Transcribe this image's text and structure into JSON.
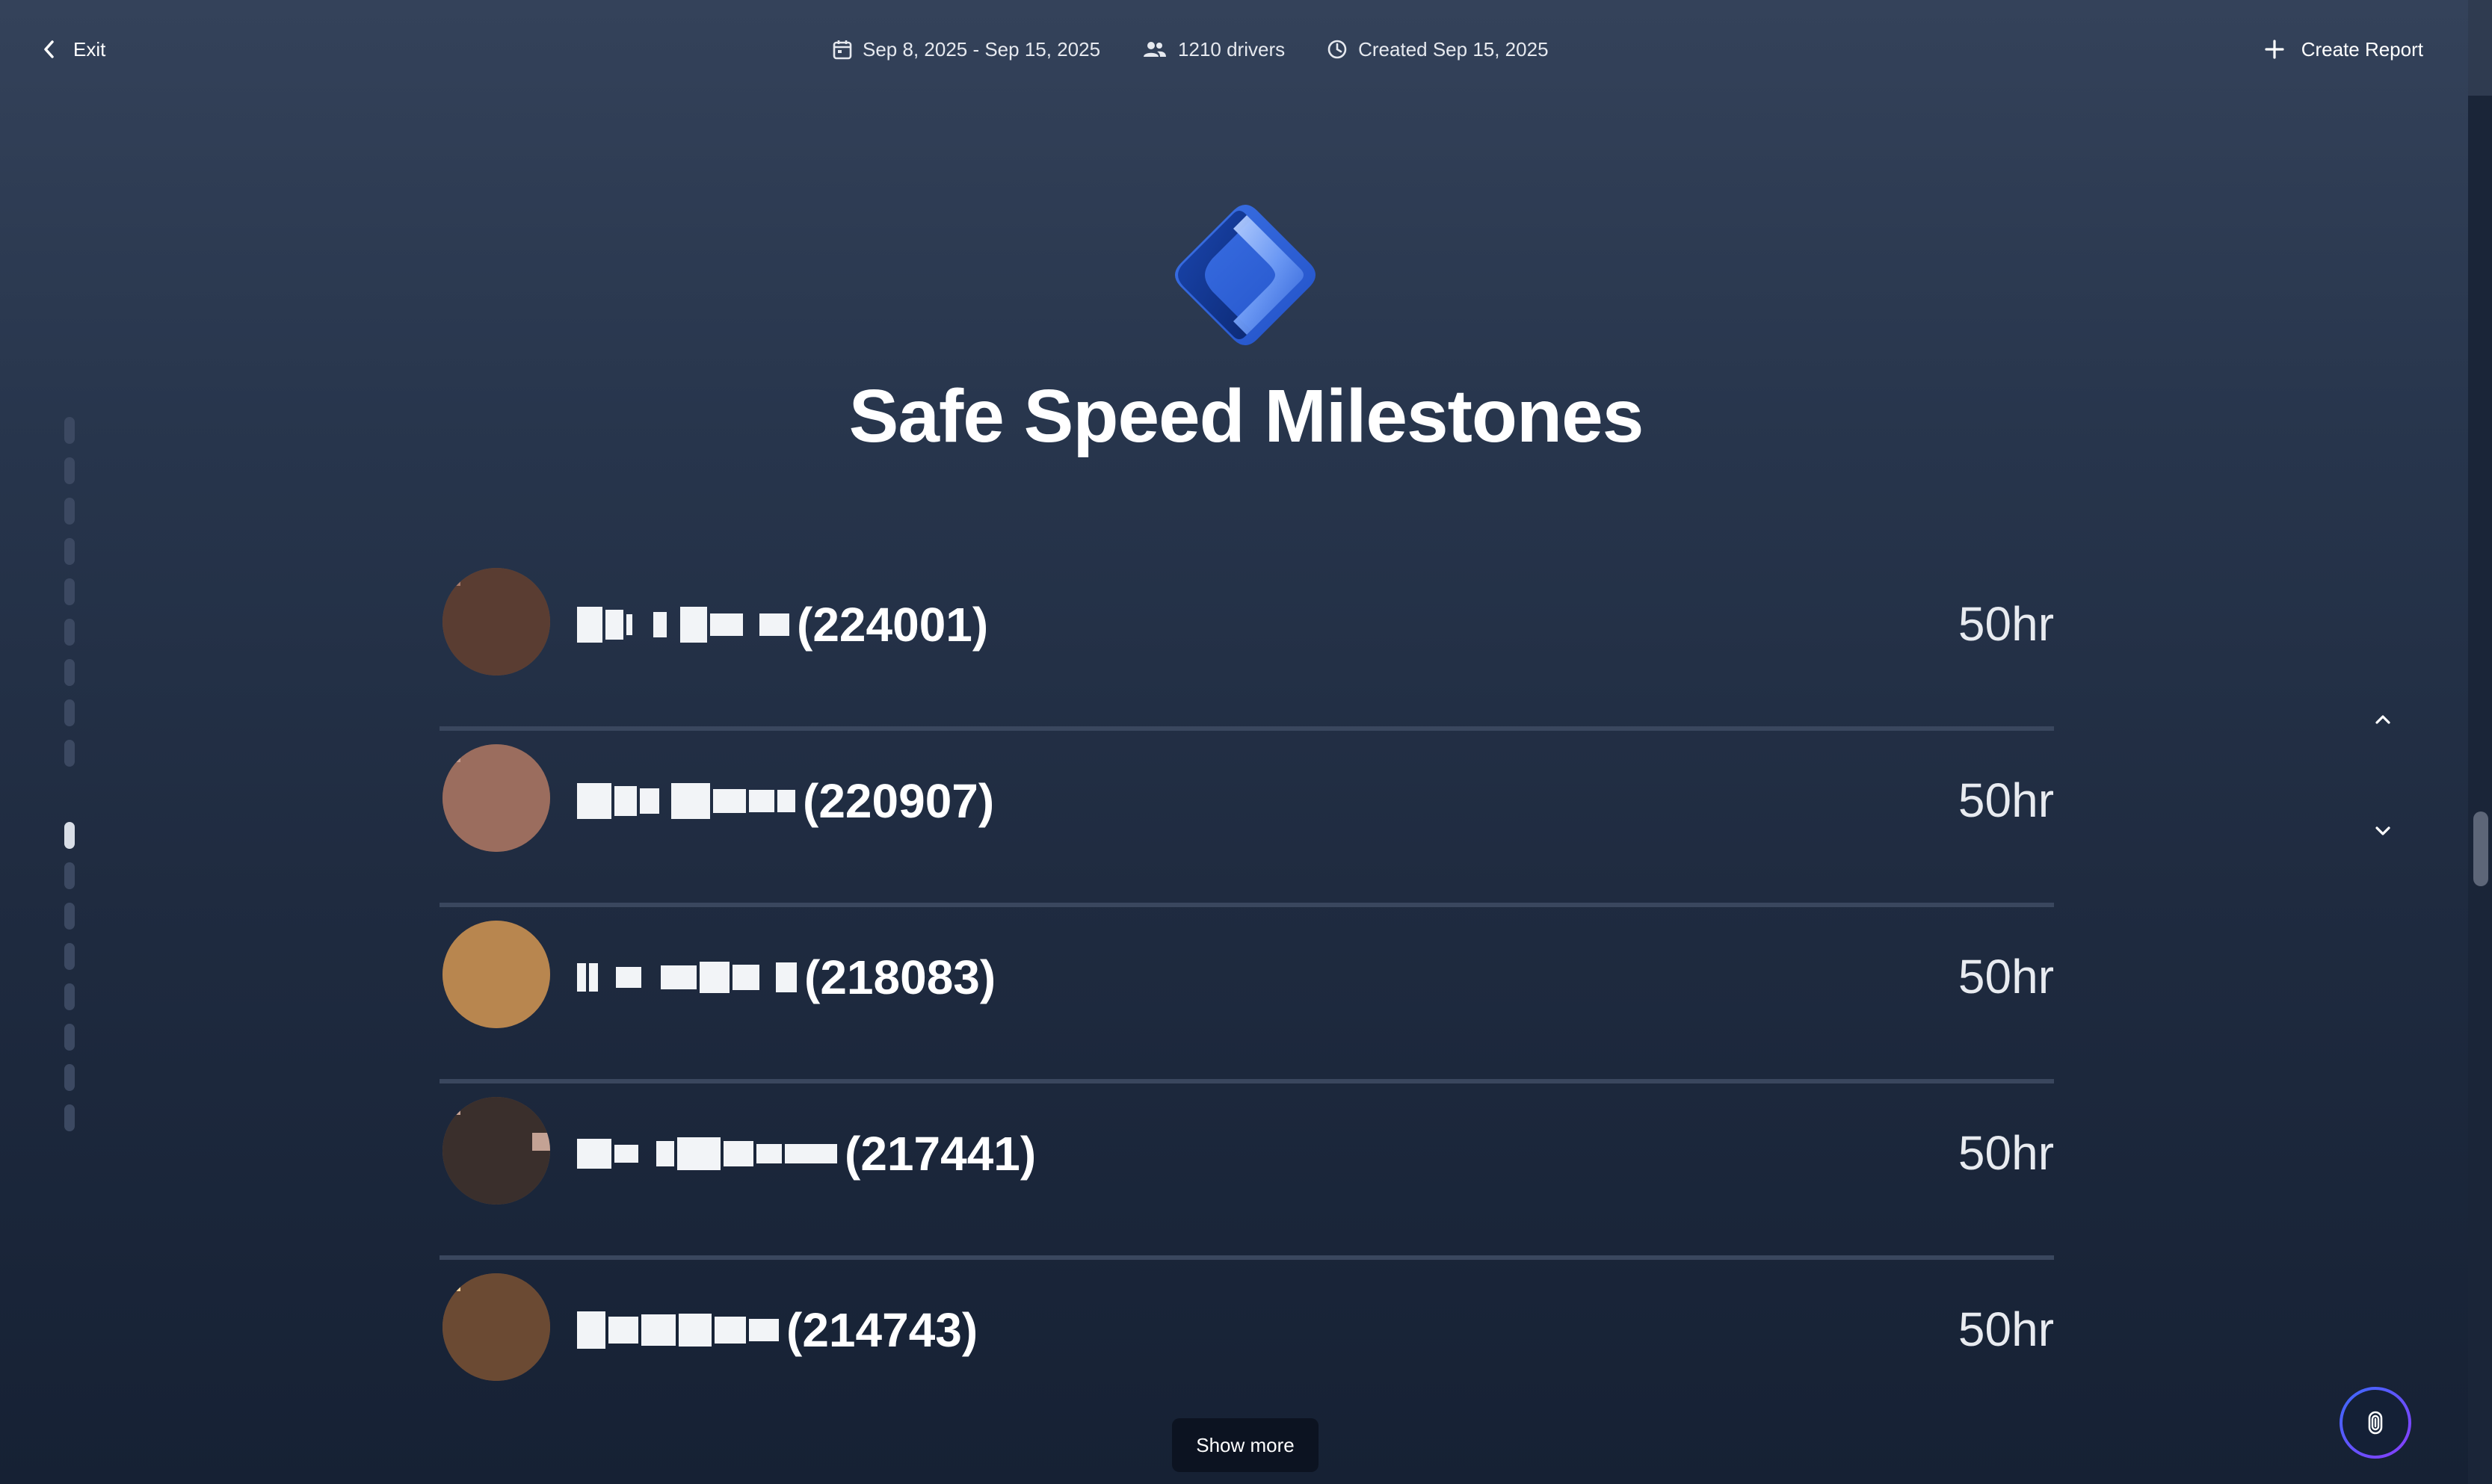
{
  "header": {
    "exit_label": "Exit",
    "date_range": "Sep 8, 2025 - Sep 15, 2025",
    "drivers": "1210 drivers",
    "created": "Created Sep 15, 2025",
    "create_report_label": "Create Report"
  },
  "page": {
    "title": "Safe Speed Milestones",
    "show_more_label": "Show more"
  },
  "drivers": [
    {
      "id_label": "(224001)",
      "hours": "50hr",
      "avatar_colors": [
        "#5a3d32",
        "#8b6155",
        "#a57a6b",
        "#6f4a3f"
      ]
    },
    {
      "id_label": "(220907)",
      "hours": "50hr",
      "avatar_colors": [
        "#9b6d5e",
        "#b8877a",
        "#7c5046",
        "#c49a8c"
      ]
    },
    {
      "id_label": "(218083)",
      "hours": "50hr",
      "avatar_colors": [
        "#b8864f",
        "#d8a76f",
        "#8f5f35",
        "#e1bb82"
      ]
    },
    {
      "id_label": "(217441)",
      "hours": "50hr",
      "avatar_colors": [
        "#3a2f2c",
        "#c4a294",
        "#8c7065",
        "#e0c3b6"
      ]
    },
    {
      "id_label": "(214743)",
      "hours": "50hr",
      "avatar_colors": [
        "#6b4a33",
        "#e4b27a",
        "#f3d29a",
        "#a0724d"
      ]
    }
  ],
  "theme": {
    "accent": "#2f63d8",
    "text": "#ffffff",
    "divider": "#3a475e"
  },
  "icons": {
    "exit": "chevron-left-icon",
    "calendar": "calendar-icon",
    "drivers": "users-icon",
    "created": "clock-icon",
    "create": "plus-icon",
    "up": "chevron-up-icon",
    "down": "chevron-down-icon",
    "assistant": "fingerprint-icon"
  }
}
